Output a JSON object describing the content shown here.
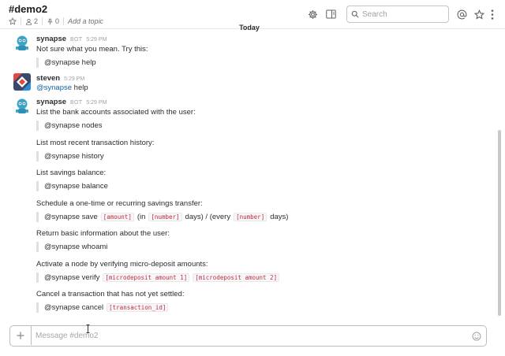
{
  "header": {
    "channel_name": "#demo2",
    "member_count": "2",
    "pinned_count": "0",
    "add_topic": "Add a topic",
    "search_placeholder": "Search"
  },
  "day_divider": "Today",
  "messages": [
    {
      "sender": "synapse",
      "tag": "BOT",
      "time": "5:29 PM",
      "lines": [
        "Not sure what you mean. Try this:"
      ],
      "quote": "@synapse help"
    },
    {
      "sender": "steven",
      "time": "5:29 PM",
      "mention": "@synapse",
      "text_after": " help"
    },
    {
      "sender": "synapse",
      "tag": "BOT",
      "time": "5:29 PM",
      "blocks": [
        {
          "heading": "List the bank accounts associated with the user:",
          "command": "@synapse nodes"
        },
        {
          "heading": "List most recent transaction history:",
          "command": "@synapse history"
        },
        {
          "heading": "List savings balance:",
          "command": "@synapse balance"
        },
        {
          "heading": "Schedule a one-time or recurring savings transfer:",
          "command": "@synapse save",
          "parts": [
            "[amount]",
            "(in",
            "[number]",
            "days) / (every",
            "[number]",
            "days)"
          ]
        },
        {
          "heading": "Return basic information about the user:",
          "command": "@synapse whoami"
        },
        {
          "heading": "Activate a node by verifying micro-deposit amounts:",
          "command": "@synapse verify",
          "parts": [
            "[microdeposit amount 1]",
            "[microdeposit amount 2]"
          ]
        },
        {
          "heading": "Cancel a transaction that has not yet settled:",
          "command": "@synapse cancel",
          "parts": [
            "[transaction_id]"
          ]
        }
      ]
    }
  ],
  "composer": {
    "placeholder": "Message #demo2"
  },
  "icons": {
    "star": "star-icon",
    "members": "person-icon",
    "pin": "pin-icon",
    "settings": "gear-icon",
    "details": "sidebar-panel-icon",
    "search": "search-icon",
    "mentions": "at-sign-icon",
    "starred": "star-outline-icon",
    "more": "kebab-menu-icon",
    "add": "plus-icon",
    "emoji": "smiley-icon"
  },
  "colors": {
    "mention": "#1264a3",
    "code": "#c02c3c",
    "bot_avatar": "#3aa3c9"
  }
}
